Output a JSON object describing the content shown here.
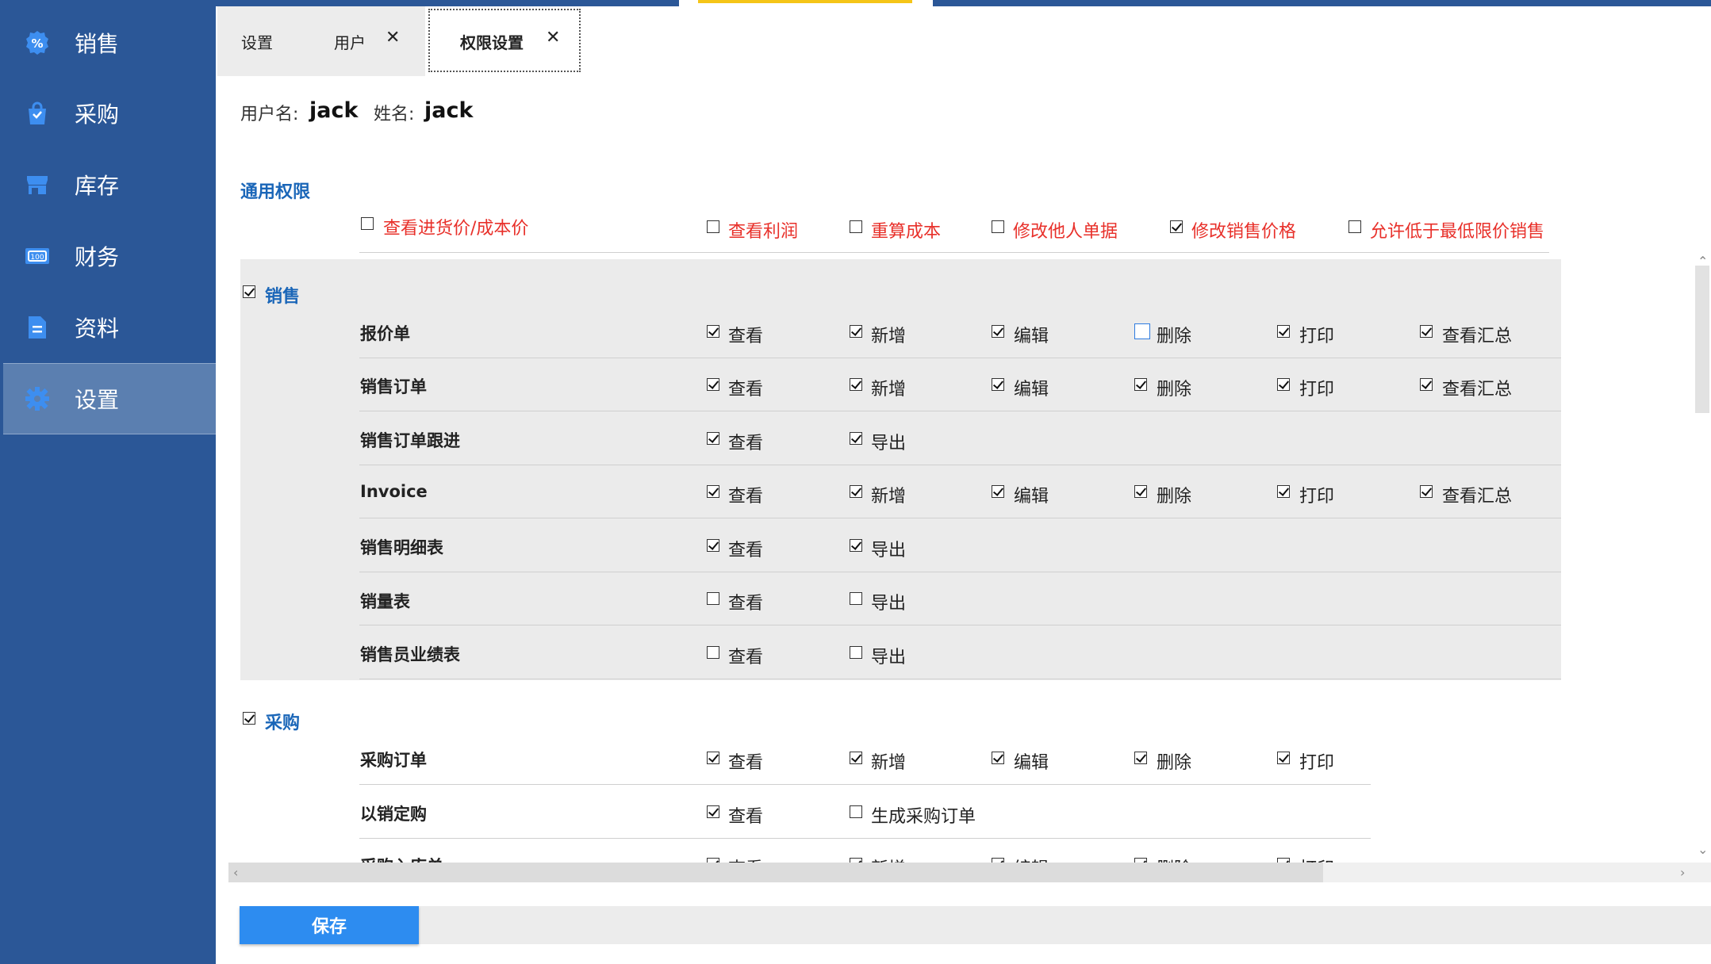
{
  "sidebar": {
    "items": [
      {
        "label": "销售",
        "icon": "sales-badge-icon"
      },
      {
        "label": "采购",
        "icon": "shopping-bag-icon"
      },
      {
        "label": "库存",
        "icon": "store-icon"
      },
      {
        "label": "财务",
        "icon": "money-icon"
      },
      {
        "label": "资料",
        "icon": "document-icon"
      },
      {
        "label": "设置",
        "icon": "gear-icon",
        "active": true
      }
    ]
  },
  "tabs": [
    {
      "label": "设置"
    },
    {
      "label": "用户",
      "close": "✕"
    },
    {
      "label": "权限设置",
      "close": "✕",
      "active": true
    }
  ],
  "user": {
    "username_label": "用户名:",
    "username": "jack",
    "name_label": "姓名:",
    "name": "jack"
  },
  "general": {
    "title": "通用权限",
    "options": [
      {
        "label": "查看进货价/成本价",
        "checked": false
      },
      {
        "label": "查看利润",
        "checked": false
      },
      {
        "label": "重算成本",
        "checked": false
      },
      {
        "label": "修改他人单据",
        "checked": false
      },
      {
        "label": "修改销售价格",
        "checked": true
      },
      {
        "label": "允许低于最低限价销售",
        "checked": false
      }
    ]
  },
  "sales": {
    "title": "销售",
    "checked": true,
    "rows": [
      {
        "name": "报价单",
        "perms": [
          {
            "label": "查看",
            "checked": true
          },
          {
            "label": "新增",
            "checked": true
          },
          {
            "label": "编辑",
            "checked": true
          },
          {
            "label": "删除",
            "checked": false,
            "focused": true
          },
          {
            "label": "打印",
            "checked": true
          },
          {
            "label": "查看汇总",
            "checked": true
          }
        ]
      },
      {
        "name": "销售订单",
        "perms": [
          {
            "label": "查看",
            "checked": true
          },
          {
            "label": "新增",
            "checked": true
          },
          {
            "label": "编辑",
            "checked": true
          },
          {
            "label": "删除",
            "checked": true
          },
          {
            "label": "打印",
            "checked": true
          },
          {
            "label": "查看汇总",
            "checked": true
          }
        ]
      },
      {
        "name": "销售订单跟进",
        "perms": [
          {
            "label": "查看",
            "checked": true
          },
          {
            "label": "导出",
            "checked": true
          }
        ]
      },
      {
        "name": "Invoice",
        "perms": [
          {
            "label": "查看",
            "checked": true
          },
          {
            "label": "新增",
            "checked": true
          },
          {
            "label": "编辑",
            "checked": true
          },
          {
            "label": "删除",
            "checked": true
          },
          {
            "label": "打印",
            "checked": true
          },
          {
            "label": "查看汇总",
            "checked": true
          }
        ]
      },
      {
        "name": "销售明细表",
        "perms": [
          {
            "label": "查看",
            "checked": true
          },
          {
            "label": "导出",
            "checked": true
          }
        ]
      },
      {
        "name": "销量表",
        "perms": [
          {
            "label": "查看",
            "checked": false
          },
          {
            "label": "导出",
            "checked": false
          }
        ]
      },
      {
        "name": "销售员业绩表",
        "perms": [
          {
            "label": "查看",
            "checked": false
          },
          {
            "label": "导出",
            "checked": false
          }
        ]
      }
    ]
  },
  "purchase": {
    "title": "采购",
    "checked": true,
    "rows": [
      {
        "name": "采购订单",
        "perms": [
          {
            "label": "查看",
            "checked": true
          },
          {
            "label": "新增",
            "checked": true
          },
          {
            "label": "编辑",
            "checked": true
          },
          {
            "label": "删除",
            "checked": true
          },
          {
            "label": "打印",
            "checked": true
          }
        ]
      },
      {
        "name": "以销定购",
        "perms": [
          {
            "label": "查看",
            "checked": true
          },
          {
            "label": "生成采购订单",
            "checked": false
          }
        ]
      },
      {
        "name": "采购入库单",
        "perms": [
          {
            "label": "查看",
            "checked": true
          },
          {
            "label": "新增",
            "checked": true
          },
          {
            "label": "编辑",
            "checked": true
          },
          {
            "label": "删除",
            "checked": true
          },
          {
            "label": "打印",
            "checked": true
          }
        ]
      }
    ]
  },
  "footer": {
    "save_label": "保存"
  },
  "colors": {
    "sidebar": "#2b5797",
    "accent": "#2d8cf0",
    "warning_text": "#e8302a",
    "section_title": "#1a66b8"
  }
}
